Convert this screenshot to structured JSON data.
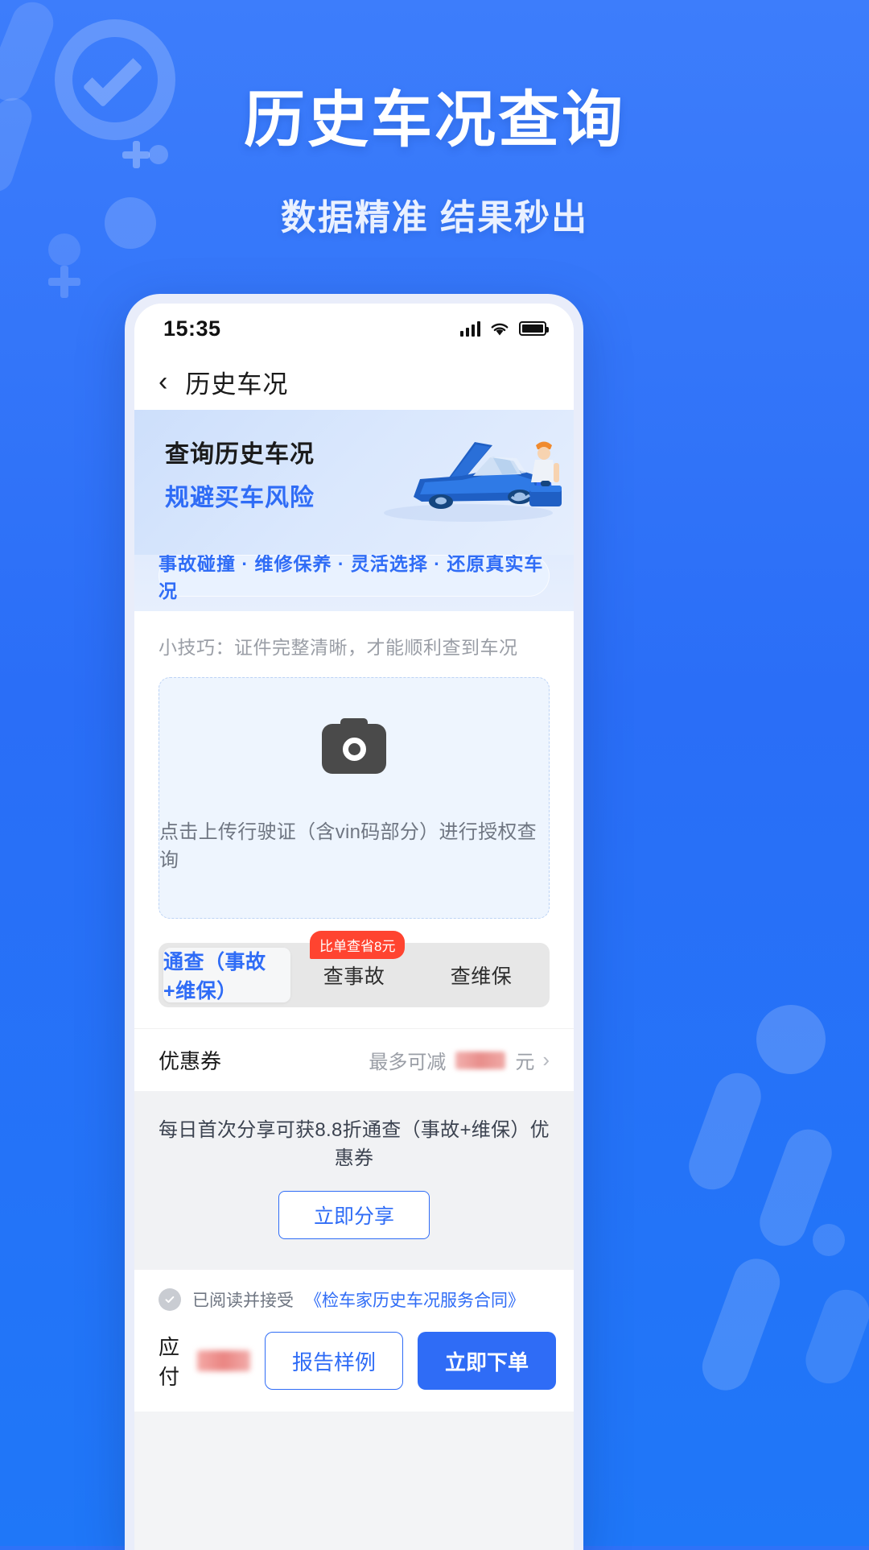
{
  "hero": {
    "title": "历史车况查询",
    "subtitle": "数据精准 结果秒出"
  },
  "phone": {
    "statusbar": {
      "time": "15:35",
      "signal_icon": "signal-bars-icon",
      "wifi_icon": "wifi-icon",
      "battery_icon": "battery-icon"
    },
    "navbar": {
      "back_icon": "chevron-left-icon",
      "title": "历史车况"
    },
    "banner": {
      "line1": "查询历史车况",
      "line2": "规避买车风险",
      "art": "car-inspection-illustration",
      "pill": "事故碰撞 · 维修保养 · 灵活选择 · 还原真实车况"
    },
    "upload": {
      "tip": "小技巧：证件完整清晰，才能顺利查到车况",
      "camera_icon": "camera-icon",
      "hint": "点击上传行驶证（含vin码部分）进行授权查询"
    },
    "tabs": {
      "badge": "比单查省8元",
      "items": [
        {
          "label": "通查（事故+维保）",
          "active": true
        },
        {
          "label": "查事故",
          "active": false
        },
        {
          "label": "查维保",
          "active": false
        }
      ]
    },
    "coupon": {
      "label": "优惠券",
      "value_prefix": "最多可减",
      "value_suffix": "元",
      "chevron_icon": "chevron-right-icon"
    },
    "share": {
      "text": "每日首次分享可获8.8折通查（事故+维保）优惠券",
      "button": "立即分享"
    },
    "agreement": {
      "check_icon": "check-circle-icon",
      "text": "已阅读并接受",
      "link": "《检车家历史车况服务合同》"
    },
    "footer": {
      "pay_label": "应付",
      "pay_value_masked": true,
      "sample_button": "报告样例",
      "order_button": "立即下单"
    }
  },
  "colors": {
    "brand_blue": "#2f6cf6",
    "page_bg": "#2f72f8",
    "badge_red": "#ff4430"
  }
}
